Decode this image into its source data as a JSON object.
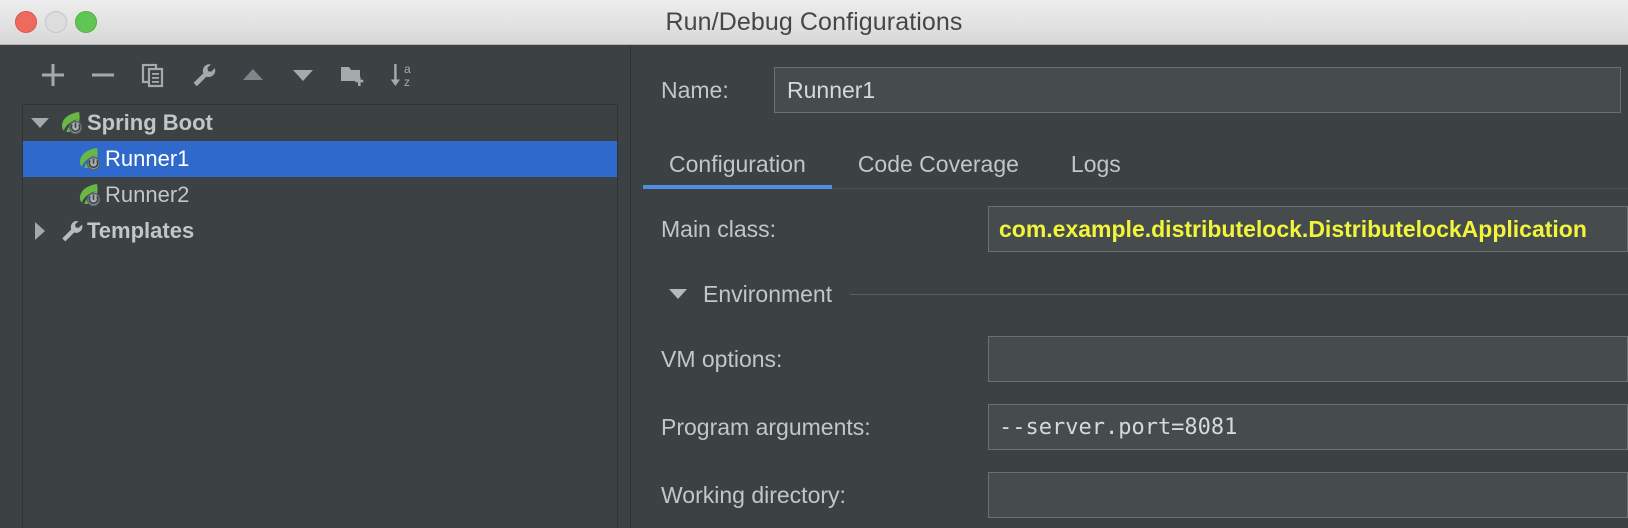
{
  "window": {
    "title": "Run/Debug Configurations",
    "traffic_lights": [
      {
        "name": "close",
        "color": "#EE6A5F"
      },
      {
        "name": "minimize",
        "color": "#DDDDDD"
      },
      {
        "name": "zoom",
        "color": "#61C555"
      }
    ]
  },
  "toolbar": {
    "items": [
      {
        "icon": "plus-icon",
        "label": "Add New Configuration"
      },
      {
        "icon": "minus-icon",
        "label": "Remove Configuration"
      },
      {
        "icon": "copy-icon",
        "label": "Copy Configuration"
      },
      {
        "icon": "wrench-icon",
        "label": "Edit Templates"
      },
      {
        "icon": "arrow-up-icon",
        "label": "Move Up"
      },
      {
        "icon": "arrow-down-icon",
        "label": "Move Down"
      },
      {
        "icon": "new-folder-icon",
        "label": "Create New Folder"
      },
      {
        "icon": "sort-alphabetical-icon",
        "label": "Sort Configurations"
      }
    ]
  },
  "tree": {
    "nodes": [
      {
        "label": "Spring Boot",
        "icon": "spring-boot-leaf-icon",
        "twisty": "expanded",
        "level": 0,
        "bold": true,
        "selected": false
      },
      {
        "label": "Runner1",
        "icon": "spring-boot-leaf-icon",
        "twisty": "none",
        "level": 1,
        "bold": false,
        "selected": true
      },
      {
        "label": "Runner2",
        "icon": "spring-boot-leaf-icon",
        "twisty": "none",
        "level": 1,
        "bold": false,
        "selected": false
      },
      {
        "label": "Templates",
        "icon": "wrench-icon",
        "twisty": "collapsed",
        "level": 0,
        "bold": true,
        "selected": false
      }
    ],
    "selection_color": "#3069CC"
  },
  "details": {
    "name_label": "Name:",
    "name_value": "Runner1",
    "tabs": [
      {
        "label": "Configuration",
        "active": true
      },
      {
        "label": "Code Coverage",
        "active": false
      },
      {
        "label": "Logs",
        "active": false
      }
    ],
    "active_tab_underline_color": "#4D90E0",
    "fields": [
      {
        "label": "Main class:",
        "value": "com.example.distributelock.DistributelockApplication",
        "highlight": true,
        "highlight_color": "#F2F53A",
        "mono": false
      },
      {
        "label": "VM options:",
        "value": "",
        "highlight": false,
        "mono": false
      },
      {
        "label": "Program arguments:",
        "value": "--server.port=8081",
        "highlight": false,
        "mono": true
      },
      {
        "label": "Working directory:",
        "value": "",
        "highlight": false,
        "mono": false
      }
    ],
    "section": {
      "label": "Environment",
      "state": "expanded"
    }
  }
}
